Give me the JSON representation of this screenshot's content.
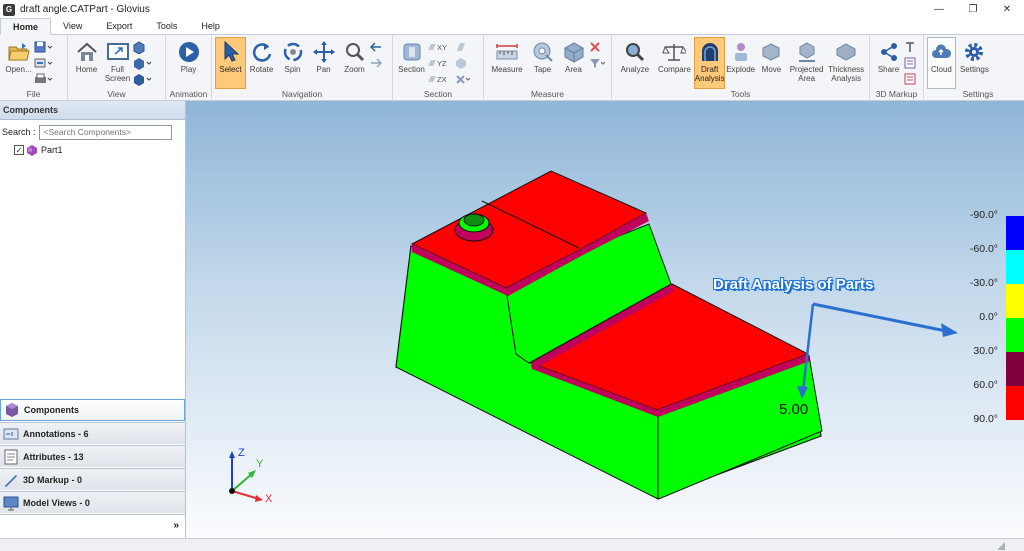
{
  "window": {
    "title": "draft angle.CATPart - Glovius",
    "app_icon_text": "G",
    "minimize": "—",
    "maximize": "❐",
    "close": "✕"
  },
  "menu": {
    "tabs": [
      "Home",
      "View",
      "Export",
      "Tools",
      "Help"
    ]
  },
  "ribbon": {
    "groups": {
      "file": "File",
      "view": "View",
      "animation": "Animation",
      "navigation": "Navigation",
      "section": "Section",
      "measure": "Measure",
      "tools": "Tools",
      "markup": "3D Markup",
      "settings": "Settings"
    },
    "tools": {
      "open": "Open...",
      "home": "Home",
      "fullscreen": "Full\nScreen",
      "play": "Play",
      "select": "Select",
      "rotate": "Rotate",
      "spin": "Spin",
      "pan": "Pan",
      "zoom": "Zoom",
      "section": "Section",
      "xy": "XY",
      "yz": "YZ",
      "zx": "ZX",
      "measure": "Measure",
      "tape": "Tape",
      "area": "Area",
      "analyze": "Analyze",
      "compare": "Compare",
      "draft": "Draft\nAnalysis",
      "explode": "Explode",
      "move": "Move",
      "projected": "Projected\nArea",
      "thickness": "Thickness\nAnalysis",
      "share": "Share",
      "cloud": "Cloud",
      "settings": "Settings"
    }
  },
  "left_panel": {
    "title": "Components",
    "search_label": "Search :",
    "search_placeholder": "<Search Components>",
    "tree": [
      {
        "label": "Part1",
        "checked": "✓"
      }
    ],
    "accordion": [
      {
        "label": "Components"
      },
      {
        "label": "Annotations - 6"
      },
      {
        "label": "Attributes - 13"
      },
      {
        "label": "3D Markup - 0"
      },
      {
        "label": "Model Views - 0"
      }
    ],
    "expand": "»"
  },
  "viewport": {
    "annotation": "Draft Analysis of Parts",
    "value_label": "5.00",
    "axes": {
      "x": "X",
      "y": "Y",
      "z": "Z"
    },
    "legend": [
      {
        "label": "-90.0°",
        "color": "#0000ff"
      },
      {
        "label": "-60.0°",
        "color": "#00ffff"
      },
      {
        "label": "-30.0°",
        "color": "#ffff00"
      },
      {
        "label": "0.0°",
        "color": "#00ff00"
      },
      {
        "label": "30.0°",
        "color": "#800040"
      },
      {
        "label": "60.0°",
        "color": "#ff0000"
      },
      {
        "label": "90.0°",
        "color": ""
      }
    ],
    "colors": {
      "face_red": "#ff0000",
      "face_green": "#00ff00",
      "edge_band": "#c0005a",
      "annotation": "#1e73d8"
    }
  }
}
